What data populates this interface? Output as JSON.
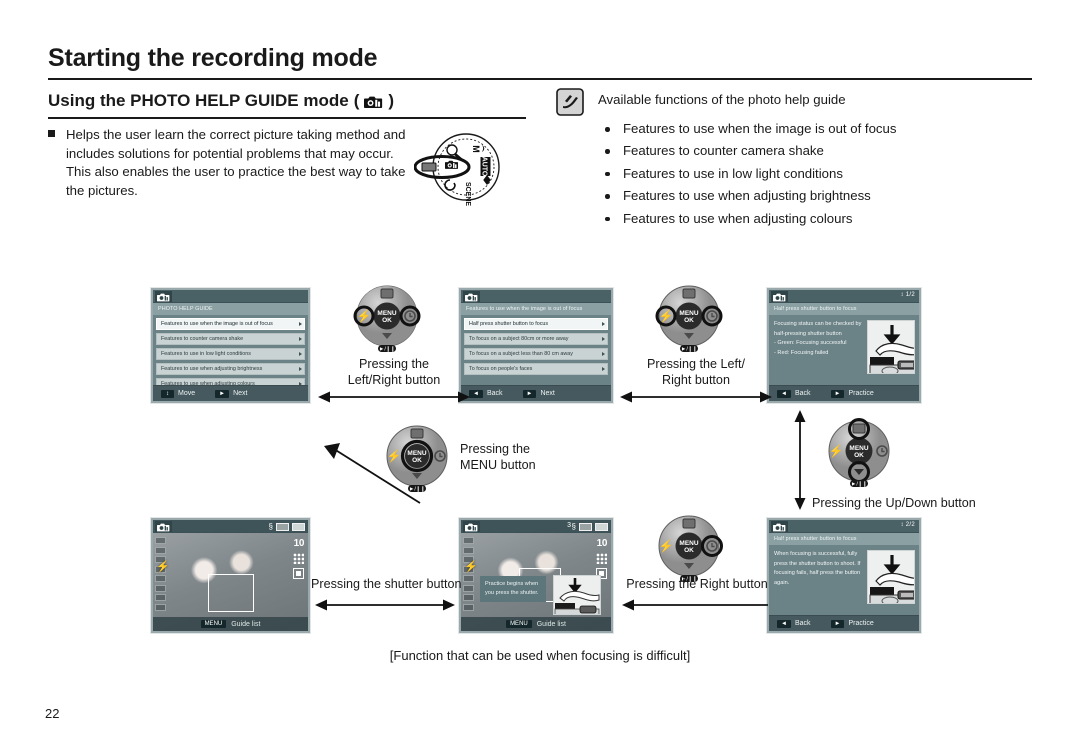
{
  "page": {
    "title": "Starting the recording mode",
    "section_title": "Using the PHOTO HELP GUIDE mode",
    "section_title_icon": "photo-help-guide-mode-icon",
    "number": "22",
    "footer_caption": "[Function that can be used when focusing is difficult]"
  },
  "intro": {
    "bullet": "■",
    "text": "Helps the user learn the correct picture taking method and includes solutions for potential problems that may occur. This also enables the user to practice the best way to take the pictures."
  },
  "mode_dial": {
    "name": "mode-dial-illustration",
    "labels": [
      "M",
      "AUTO",
      "SCENE"
    ],
    "highlighted": "PHOTO HELP GUIDE"
  },
  "note": {
    "icon": "note-pen-icon",
    "heading": "Available functions of the photo help guide",
    "items": [
      "Features to use when the image is out of focus",
      "Features to counter camera shake",
      "Features to use in low light conditions",
      "Features to use when adjusting brightness",
      "Features to use when adjusting colours"
    ]
  },
  "screens": {
    "menu_main": {
      "name": "lcd-photo-help-guide-menu",
      "mode_icon": "photo-help-guide-icon",
      "subhead": "PHOTO HELP GUIDE",
      "rows": [
        "Features to use when the image is out of focus",
        "Features to counter camera shake",
        "Features to use in low light conditions",
        "Features to use when adjusting brightness",
        "Features to use when adjusting colours"
      ],
      "selected_index": 0,
      "buttons": [
        {
          "key": "↕",
          "label": "Move"
        },
        {
          "key": "►",
          "label": "Next"
        }
      ]
    },
    "menu_focus": {
      "name": "lcd-out-of-focus-submenu",
      "mode_icon": "photo-help-guide-icon",
      "subhead": "Features to use when the image is out of focus",
      "rows": [
        "Half press shutter button to focus",
        "To focus on a subject 80cm or more away",
        "To focus on a subject less than 80 cm away",
        "To focus on people's faces"
      ],
      "selected_index": 0,
      "buttons": [
        {
          "key": "◄",
          "label": "Back"
        },
        {
          "key": "►",
          "label": "Next"
        }
      ]
    },
    "help_page1": {
      "name": "lcd-help-detail-page-1",
      "mode_icon": "photo-help-guide-icon",
      "page_indicator": "1/2",
      "subhead": "Half press shutter button to focus",
      "body": "Focusing status can be checked by half-pressing shutter button\n- Green: Focusing successful\n- Red: Focusing failed",
      "illustration": "half-press-shutter-hand-illustration",
      "buttons": [
        {
          "key": "◄",
          "label": "Back"
        },
        {
          "key": "►",
          "label": "Practice"
        }
      ]
    },
    "help_page2": {
      "name": "lcd-help-detail-page-2",
      "mode_icon": "photo-help-guide-icon",
      "page_indicator": "2/2",
      "subhead": "Half press shutter button to focus",
      "body": "When focusing is successful, fully press the shutter button to shoot. If focusing fails, half press the button again.",
      "illustration": "full-press-shutter-hand-illustration",
      "buttons": [
        {
          "key": "◄",
          "label": "Back"
        },
        {
          "key": "►",
          "label": "Practice"
        }
      ]
    },
    "live_plain": {
      "name": "lcd-live-view-guide-list",
      "mode_icon": "photo-help-guide-icon",
      "resolution": "10",
      "flash_icon": "flash-auto-icon",
      "menu_key": "MENU",
      "menu_label": "Guide list"
    },
    "live_practice": {
      "name": "lcd-live-view-practice",
      "mode_icon": "photo-help-guide-icon",
      "resolution": "10",
      "counter": "3",
      "flash_icon": "flash-auto-icon",
      "tooltip": "Practice begins when you press the shutter.",
      "illustration": "press-shutter-hand-illustration",
      "menu_key": "MENU",
      "menu_label": "Guide list"
    }
  },
  "dpads": {
    "left_right_top": {
      "name": "dpad-left-right-highlight",
      "center": "MENU OK"
    },
    "left_right_mid": {
      "name": "dpad-left-right-highlight-2",
      "center": "MENU OK"
    },
    "menu_button": {
      "name": "dpad-menu-ok-highlight",
      "center": "MENU OK"
    },
    "up_down": {
      "name": "dpad-up-down-highlight",
      "center": "MENU OK"
    },
    "right_button": {
      "name": "dpad-right-highlight",
      "center": "MENU OK"
    }
  },
  "flow_captions": {
    "left_right_button": "Pressing the\nLeft/Right button",
    "left_right_button_2": "Pressing the  Left/\nRight button",
    "menu_button": "Pressing the\nMENU button",
    "up_down_button": "Pressing the Up/Down button",
    "shutter_button": "Pressing the shutter button",
    "right_button": "Pressing the Right button"
  }
}
